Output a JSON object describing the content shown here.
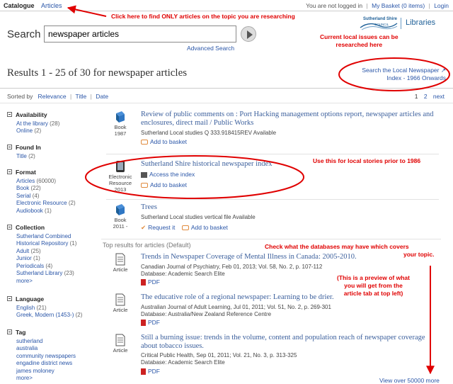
{
  "topbar": {
    "tab_catalogue": "Catalogue",
    "tab_articles": "Articles",
    "login_status": "You are not logged in",
    "basket": "My Basket (0 items)",
    "login": "Login"
  },
  "logo": {
    "org": "Sutherland Shire",
    "council": "COUNCIL",
    "libraries": "Libraries"
  },
  "search": {
    "label": "Search",
    "value": "newspaper articles",
    "advanced": "Advanced Search"
  },
  "results_header": {
    "title": "Results 1 - 25 of 30 for newspaper articles",
    "local_link_line1": "Search the Local Newspaper",
    "local_link_line2": "Index - 1966 Onwards"
  },
  "sort": {
    "label": "Sorted by",
    "relevance": "Relevance",
    "title": "Title",
    "date": "Date",
    "pages": [
      "1",
      "2"
    ],
    "next": "next"
  },
  "facets": [
    {
      "heading": "Availability",
      "items": [
        {
          "label": "At the library",
          "count": "(28)"
        },
        {
          "label": "Online",
          "count": "(2)"
        }
      ]
    },
    {
      "heading": "Found In",
      "items": [
        {
          "label": "Title",
          "count": "(2)"
        }
      ]
    },
    {
      "heading": "Format",
      "items": [
        {
          "label": "Articles",
          "count": "(60000)"
        },
        {
          "label": "Book",
          "count": "(22)"
        },
        {
          "label": "Serial",
          "count": "(4)"
        },
        {
          "label": "Electronic Resource",
          "count": "(2)"
        },
        {
          "label": "Audiobook",
          "count": "(1)"
        }
      ]
    },
    {
      "heading": "Collection",
      "items": [
        {
          "label": "Sutherland Combined",
          "count": ""
        },
        {
          "label": "Historical Repository",
          "count": "(1)"
        },
        {
          "label": "Adult",
          "count": "(25)"
        },
        {
          "label": "Junior",
          "count": "(1)"
        },
        {
          "label": "Periodicals",
          "count": "(4)"
        },
        {
          "label": "Sutherland Library",
          "count": "(23)"
        }
      ],
      "more": "more>"
    },
    {
      "heading": "Language",
      "items": [
        {
          "label": "English",
          "count": "(21)"
        },
        {
          "label": "Greek, Modern (1453-)",
          "count": "(2)"
        }
      ]
    },
    {
      "heading": "Tag",
      "items": [
        {
          "label": "sutherland",
          "count": ""
        },
        {
          "label": "australia",
          "count": ""
        },
        {
          "label": "community newspapers",
          "count": ""
        },
        {
          "label": "engadine district news",
          "count": ""
        },
        {
          "label": "james moloney",
          "count": ""
        }
      ],
      "more": "more>"
    }
  ],
  "catalogue_results": [
    {
      "format": "Book",
      "year": "1987",
      "title": "Review of public comments on : Port Hacking management options report, newspaper articles and enclosures, direct mail / Public Works",
      "meta": "Sutherland Local studies  Q 333.918415REV     Available",
      "action": "Add to basket"
    },
    {
      "format": "Electronic Resource",
      "year": "2013",
      "title": "Sutherland Shire historical newspaper index",
      "access": "Access the index",
      "action": "Add to basket"
    },
    {
      "format": "Book",
      "year": "2011 -",
      "title": "Trees",
      "meta": "Sutherland Local studies vertical file     Available",
      "request": "Request it",
      "action": "Add to basket"
    }
  ],
  "top_results_label": "Top results for articles (Default)",
  "article_results": [
    {
      "format": "Article",
      "title": "Trends in Newspaper Coverage of Mental Illness in Canada: 2005-2010.",
      "meta": "Canadian Journal of Psychiatry, Feb 01, 2013; Vol. 58, No. 2, p. 107-112",
      "database": "Database: Academic Search Elite",
      "pdf": "PDF"
    },
    {
      "format": "Article",
      "title": "The educative role of a regional newspaper: Learning to be drier.",
      "meta": "Australian Journal of Adult Learning, Jul 01, 2011; Vol. 51, No. 2, p. 269-301",
      "database": "Database: Australia/New Zealand Reference Centre",
      "pdf": "PDF"
    },
    {
      "format": "Article",
      "title": "Still a burning issue: trends in the volume, content and population reach of newspaper coverage about tobacco issues.",
      "meta": "Critical Public Health, Sep 01, 2011; Vol. 21, No. 3, p. 313-325",
      "database": "Database: Academic Search Elite",
      "pdf": "PDF"
    }
  ],
  "view_more": "View over 50000 more",
  "annotations": {
    "articles_tab": "Click here to find ONLY articles on the topic you are researching",
    "local_issues_1": "Current local issues can be",
    "local_issues_2": "researched here",
    "local_stories": "Use this for local stories prior to 1986",
    "databases_1": "Check what the databases may have which covers",
    "databases_2": "your topic.",
    "preview_1": "(This is a preview of what",
    "preview_2": "you will get from the",
    "preview_3": "article tab at top left)"
  },
  "colors": {
    "link": "#2a56a8",
    "annotation": "#e00000",
    "title": "#3b5f9c"
  }
}
